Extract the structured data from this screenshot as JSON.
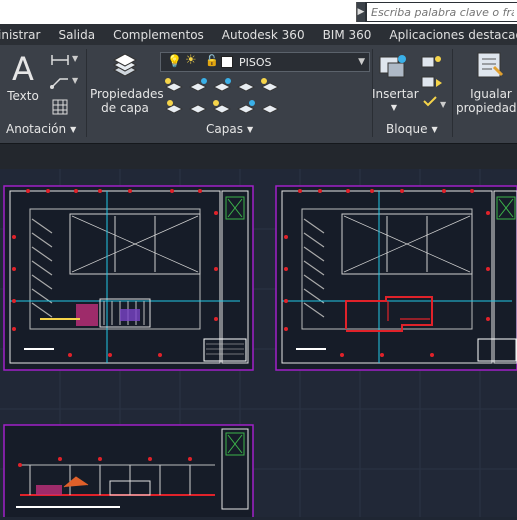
{
  "search": {
    "placeholder": "Escriba palabra clave o frase"
  },
  "tabs": [
    "inistrar",
    "Salida",
    "Complementos",
    "Autodesk 360",
    "BIM 360",
    "Aplicaciones destacadas"
  ],
  "ribbon": {
    "texto_label": "Texto",
    "anotacion_title": "Anotación",
    "propiedades_line1": "Propiedades",
    "propiedades_line2": "de capa",
    "capas_title": "Capas",
    "current_layer": "PISOS",
    "insertar_label": "Insertar",
    "bloque_title": "Bloque",
    "igualar_line1": "Igualar",
    "igualar_line2": "propiedades"
  },
  "colors": {
    "ribbon_bg": "#3b4048",
    "canvas_bg": "#212837",
    "viewport_border": "#a020c8",
    "accent_red": "#e0222a",
    "accent_cyan": "#22c8e6"
  }
}
